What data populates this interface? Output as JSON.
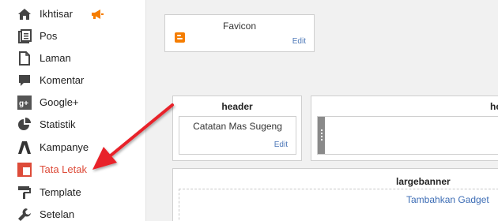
{
  "sidebar": {
    "items": [
      {
        "label": "Ikhtisar"
      },
      {
        "label": "Pos"
      },
      {
        "label": "Laman"
      },
      {
        "label": "Komentar"
      },
      {
        "label": "Google+"
      },
      {
        "label": "Statistik"
      },
      {
        "label": "Kampanye"
      },
      {
        "label": "Tata Letak"
      },
      {
        "label": "Template"
      },
      {
        "label": "Setelan"
      }
    ],
    "active": "Tata Letak"
  },
  "layout": {
    "favicon": {
      "title": "Favicon",
      "edit_label": "Edit"
    },
    "header": {
      "title": "header",
      "gadget_name": "Catatan Mas Sugeng",
      "edit_label": "Edit"
    },
    "header2": {
      "title": "he"
    },
    "largebanner": {
      "title": "largebanner",
      "add_label": "Tambahkan Gadget"
    }
  },
  "colors": {
    "accent": "#dd4b39",
    "link": "#4d78b8",
    "arrow": "#e8242b",
    "blogger_orange": "#f57d00"
  }
}
